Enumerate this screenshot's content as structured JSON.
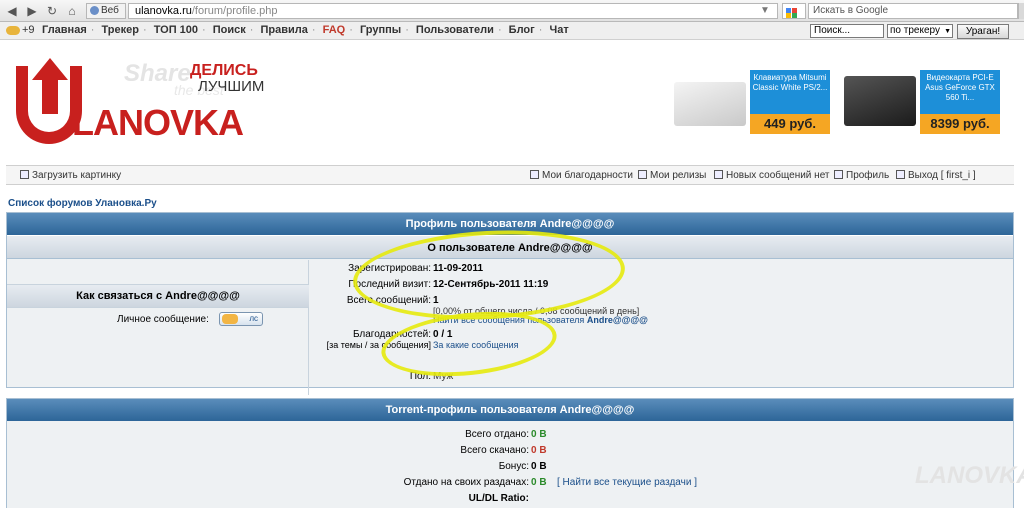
{
  "browser": {
    "url_domain": "ulanovka.ru",
    "url_path": "/forum/profile.php",
    "web_label": "Веб",
    "search_placeholder": "Искать в Google"
  },
  "topmenu": {
    "weather": "+9",
    "items": [
      "Главная",
      "Трекер",
      "ТОП 100",
      "Поиск",
      "Правила",
      "FAQ",
      "Группы",
      "Пользователи",
      "Блог",
      "Чат"
    ],
    "search_value": "Поиск...",
    "search_scope": "по трекеру",
    "search_button": "Ураган!"
  },
  "logo": {
    "brand": "LANOVKA",
    "slogan_line1": "ДЕЛИСЬ",
    "slogan_line2": "ЛУЧШИМ",
    "share_word": "Share",
    "share_sub": "the best"
  },
  "ads": [
    {
      "title": "Клавиатура Mitsumi Classic White PS/2...",
      "price": "449 руб."
    },
    {
      "title": "Видеокарта PCI-E Asus GeForce GTX 560 Ti...",
      "price": "8399 руб."
    }
  ],
  "userbar": {
    "upload_image": "Загрузить картинку",
    "thanks": "Мои благодарности",
    "releases": "Мои релизы",
    "new_messages": "Новых сообщений нет",
    "profile": "Профиль",
    "logout": "Выход [ first_i ]"
  },
  "breadcrumb": "Список форумов Улановка.Ру",
  "profile": {
    "title": "Профиль пользователя Andre@@@@",
    "about_header": "О пользователе Andre@@@@",
    "contact_header": "Как связаться с Andre@@@@",
    "pm_label": "Личное сообщение:",
    "pm_button": "лс",
    "registered_label": "Зарегистрирован:",
    "registered_value": "11-09-2011",
    "last_visit_label": "Последний визит:",
    "last_visit_value": "12-Сентябрь-2011 11:19",
    "total_posts_label": "Всего сообщений:",
    "total_posts_value": "1",
    "posts_stats": "[0,00% от общего числа / 0,08 сообщений в день]",
    "find_posts": "Найти все сообщения пользователя",
    "find_posts_user": "Andre@@@@",
    "thanks_label": "Благодарностей:",
    "thanks_sub_label": "[за темы / за сообщения]",
    "thanks_value": "0 / 1",
    "thanks_link": "За какие сообщения",
    "gender_label": "Пол:",
    "gender_value": "Муж"
  },
  "torrent": {
    "title": "Torrent-профиль пользователя Andre@@@@",
    "uploaded_label": "Всего отдано:",
    "uploaded_value": "0 B",
    "downloaded_label": "Всего скачано:",
    "downloaded_value": "0 B",
    "bonus_label": "Бонус:",
    "bonus_value": "0 B",
    "seeding_label": "Отдано на своих раздачах:",
    "seeding_value": "0 B",
    "seeding_link": "[ Найти все текущие раздачи ]",
    "ratio_label": "UL/DL Ratio:"
  },
  "watermark": "LANOVKA"
}
